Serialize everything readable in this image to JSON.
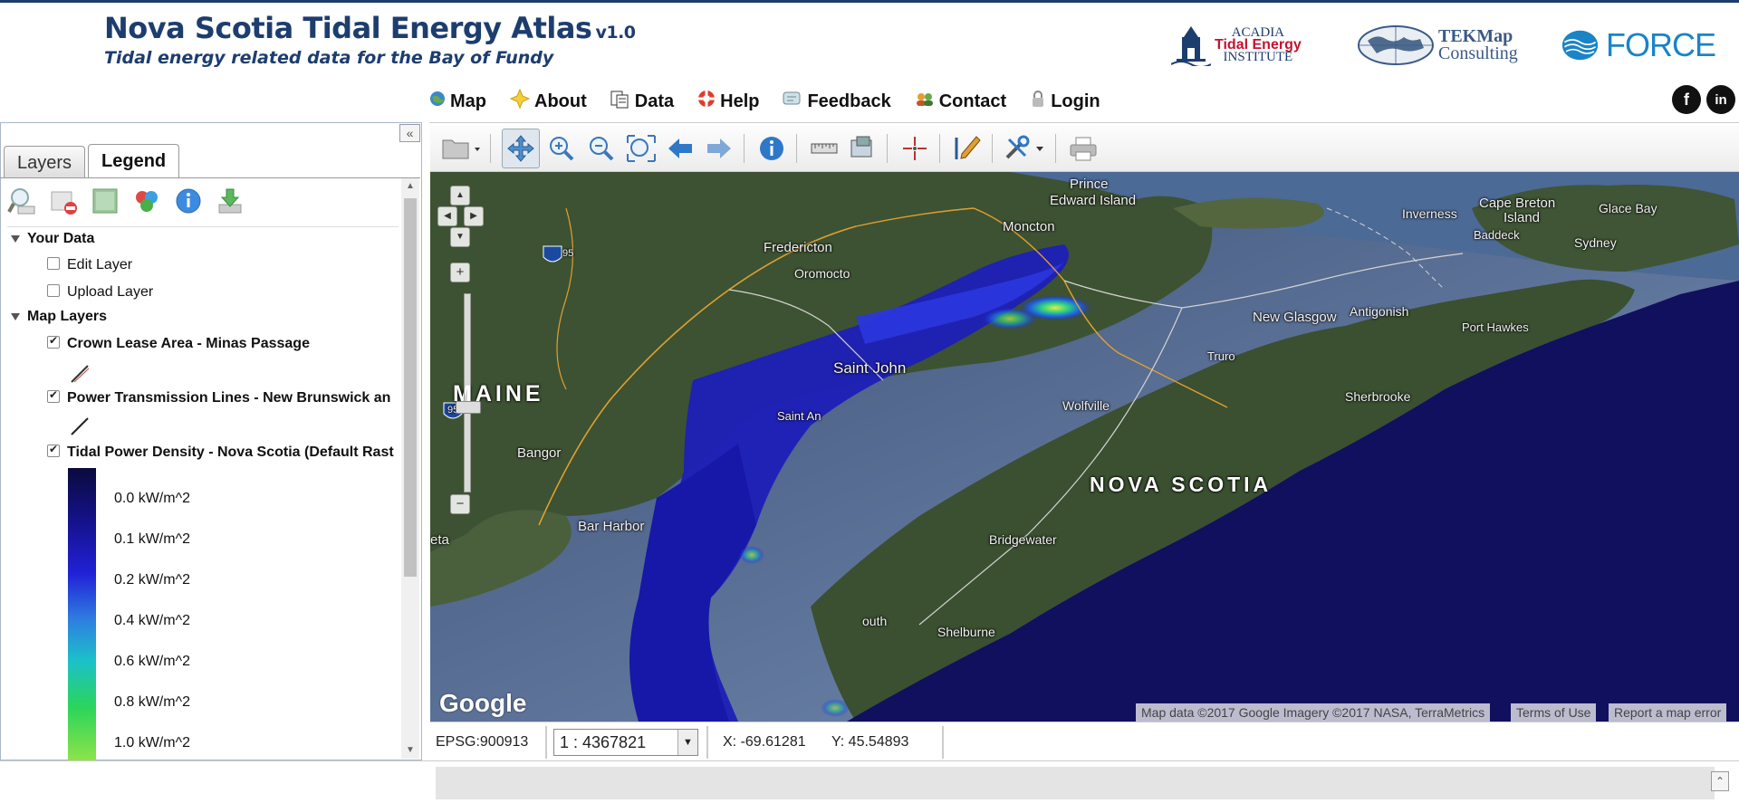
{
  "header": {
    "title": "Nova Scotia Tidal Energy Atlas",
    "version": "v1.0",
    "subtitle": "Tidal energy related data for the Bay of Fundy",
    "logos": {
      "acadia_line1": "ACADIA",
      "acadia_line2": "Tidal Energy",
      "acadia_line3": "INSTITUTE",
      "tek_line1": "TEKMap",
      "tek_line2": "Consulting",
      "force": "FORCE"
    },
    "social": {
      "facebook": "f",
      "linkedin": "in"
    }
  },
  "nav": [
    {
      "label": "Map",
      "icon": "globe-icon"
    },
    {
      "label": "About",
      "icon": "star-icon"
    },
    {
      "label": "Data",
      "icon": "data-icon"
    },
    {
      "label": "Help",
      "icon": "lifebuoy-icon"
    },
    {
      "label": "Feedback",
      "icon": "feedback-icon"
    },
    {
      "label": "Contact",
      "icon": "contact-icon"
    },
    {
      "label": "Login",
      "icon": "lock-icon"
    }
  ],
  "panel": {
    "tabs": [
      {
        "label": "Layers",
        "active": false
      },
      {
        "label": "Legend",
        "active": true
      }
    ],
    "sections": {
      "your_data": "Your Data",
      "edit_layer": "Edit Layer",
      "upload_layer": "Upload Layer",
      "map_layers": "Map Layers"
    },
    "layers": [
      {
        "label": "Crown Lease Area - Minas Passage",
        "checked": true
      },
      {
        "label": "Power Transmission Lines - New Brunswick an",
        "checked": true
      },
      {
        "label": "Tidal Power Density - Nova Scotia (Default Rast",
        "checked": true
      }
    ],
    "ramp_labels": [
      "0.0  kW/m^2",
      "0.1  kW/m^2",
      "0.2  kW/m^2",
      "0.4  kW/m^2",
      "0.6  kW/m^2",
      "0.8  kW/m^2",
      "1.0  kW/m^2"
    ],
    "ramp_colors": [
      "#0b0a3d",
      "#14128a",
      "#2121d6",
      "#2e7fe0",
      "#1bc1c9",
      "#2bd55a",
      "#8de34a"
    ]
  },
  "map": {
    "labels": {
      "pei1": "Prince",
      "pei2": "Edward Island",
      "moncton": "Moncton",
      "fredericton": "Fredericton",
      "oromocto": "Oromocto",
      "saint_john": "Saint John",
      "maine": "MAINE",
      "bangor": "Bangor",
      "bar_harbor": "Bar Harbor",
      "eta": "eta",
      "inverness": "Inverness",
      "cape_breton1": "Cape Breton",
      "cape_breton2": "Island",
      "glace_bay": "Glace Bay",
      "baddeck": "Baddeck",
      "sydney": "Sydney",
      "new_glasgow": "New Glasgow",
      "antigonish": "Antigonish",
      "port_hawkesbury": "Port Hawkes",
      "truro": "Truro",
      "wolfville": "Wolfville",
      "sherbrooke": "Sherbrooke",
      "nova_scotia": "NOVA SCOTIA",
      "bridgewater": "Bridgewater",
      "shelburne": "Shelburne",
      "yarmouth": "outh",
      "saint_an": "Saint An",
      "i95a": "95",
      "i95b": "95"
    },
    "google": "Google",
    "attribution": "Map data ©2017 Google Imagery ©2017 NASA, TerraMetrics",
    "terms": "Terms of Use",
    "report": "Report a map error"
  },
  "status": {
    "epsg": "EPSG:900913",
    "scale": "1 : 4367821",
    "x": "X: -69.61281",
    "y": "Y: 45.54893"
  }
}
